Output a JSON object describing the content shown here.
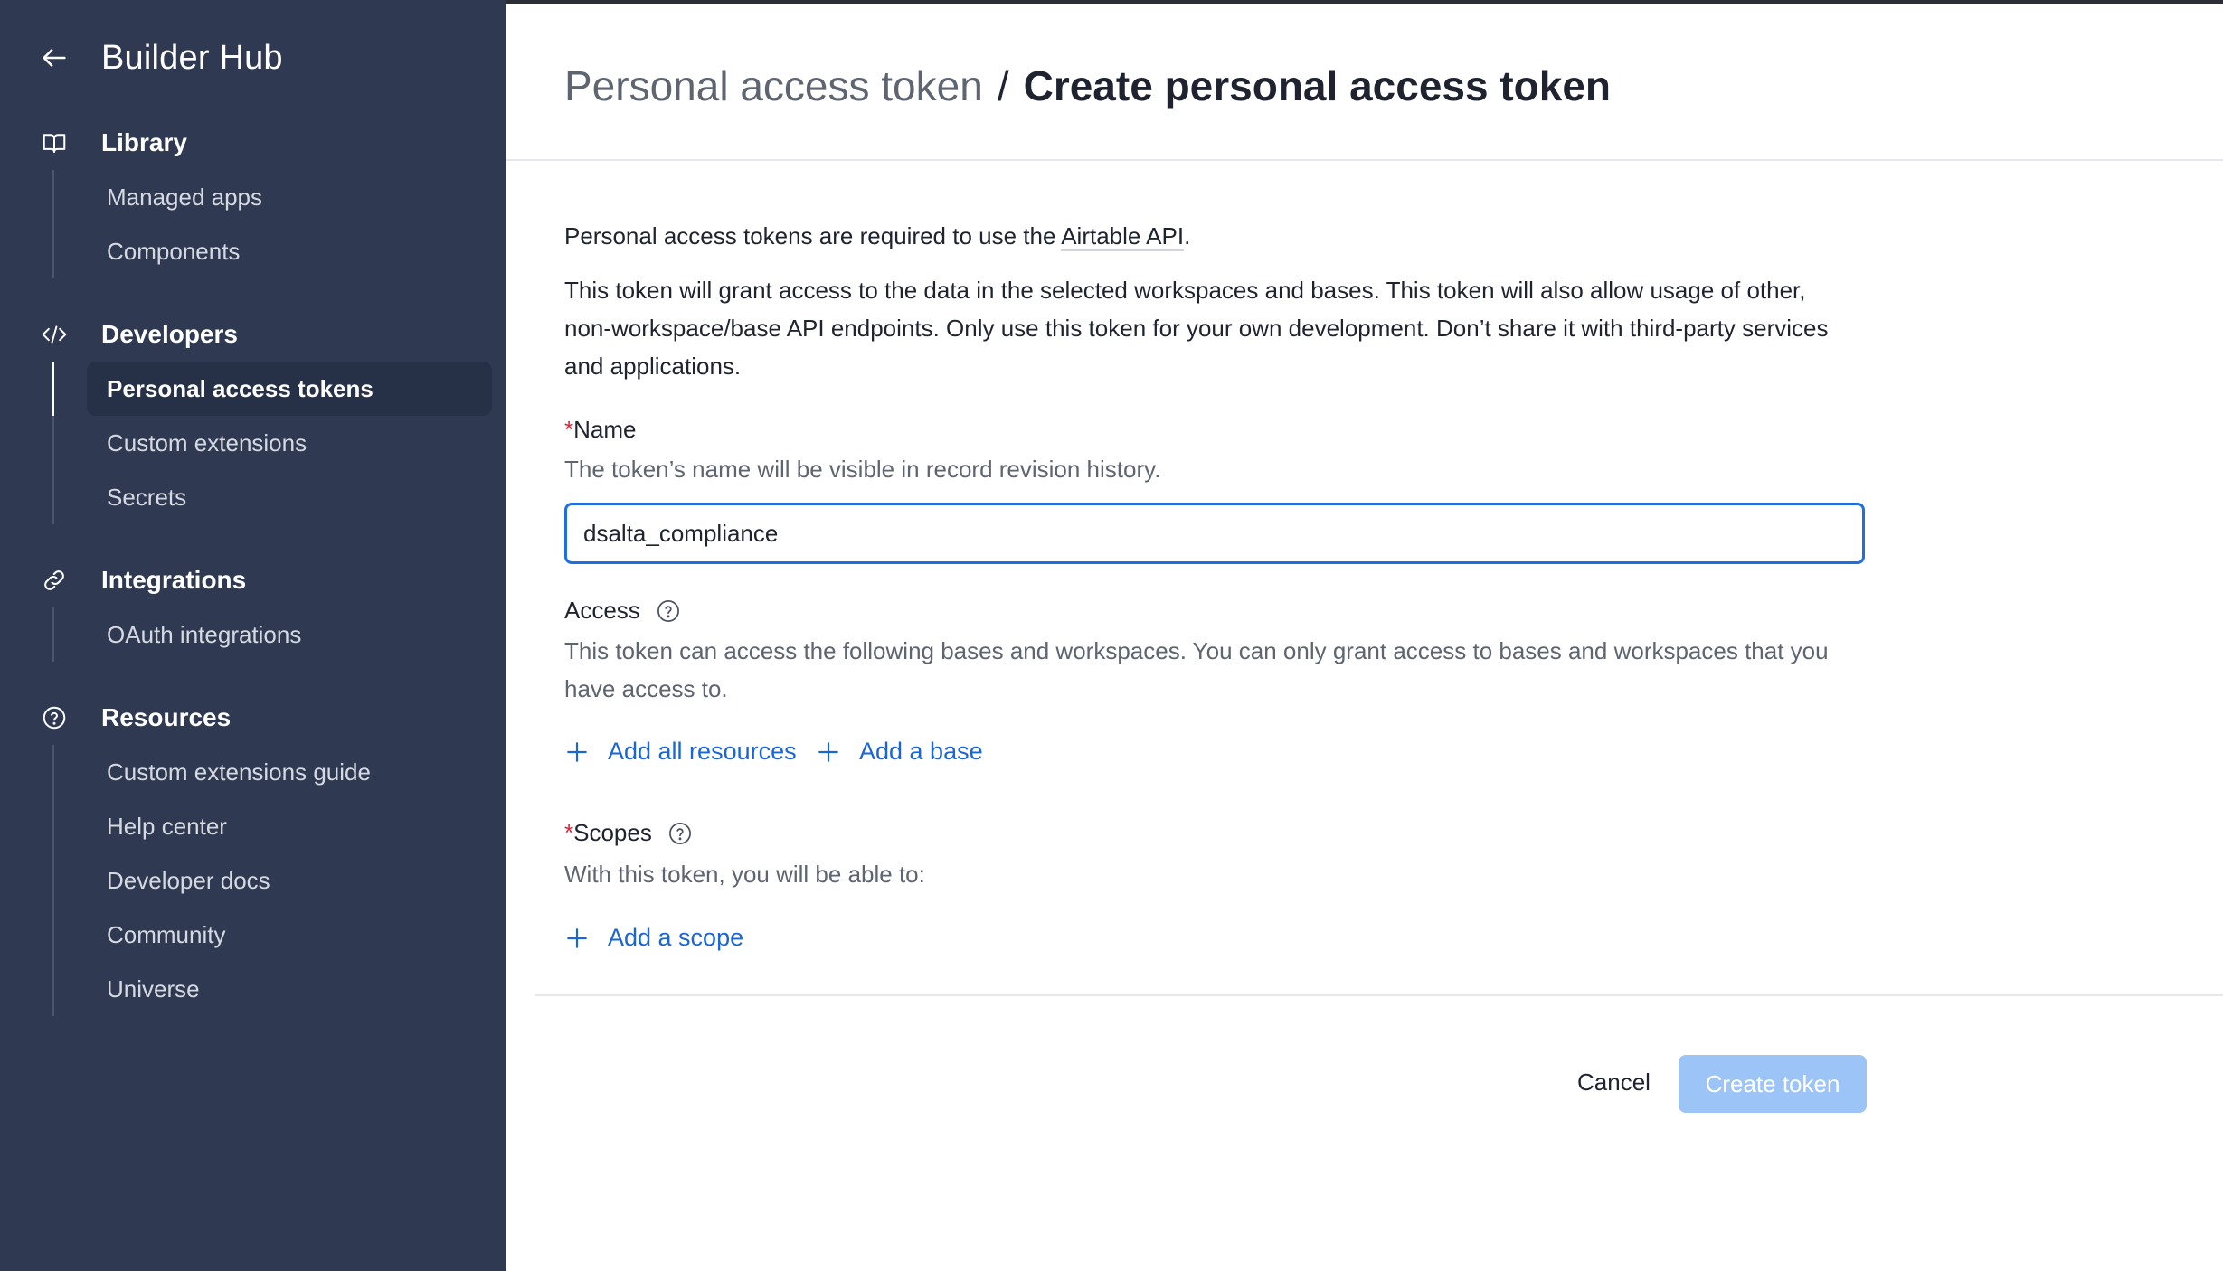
{
  "sidebar": {
    "title": "Builder Hub",
    "sections": [
      {
        "label": "Library",
        "icon": "book-icon",
        "items": [
          {
            "label": "Managed apps"
          },
          {
            "label": "Components"
          }
        ]
      },
      {
        "label": "Developers",
        "icon": "code-icon",
        "items": [
          {
            "label": "Personal access tokens",
            "active": true
          },
          {
            "label": "Custom extensions"
          },
          {
            "label": "Secrets"
          }
        ]
      },
      {
        "label": "Integrations",
        "icon": "link-icon",
        "items": [
          {
            "label": "OAuth integrations"
          }
        ]
      },
      {
        "label": "Resources",
        "icon": "help-circle-icon",
        "items": [
          {
            "label": "Custom extensions guide"
          },
          {
            "label": "Help center"
          },
          {
            "label": "Developer docs"
          },
          {
            "label": "Community"
          },
          {
            "label": "Universe"
          }
        ]
      }
    ]
  },
  "header": {
    "parent": "Personal access token",
    "separator": "/",
    "current": "Create personal access token"
  },
  "intro": {
    "line1_prefix": "Personal access tokens are required to use the ",
    "line1_link": "Airtable API",
    "line1_suffix": ".",
    "line2": "This token will grant access to the data in the selected workspaces and bases. This token will also allow usage of other, non-workspace/base API endpoints. Only use this token for your own development. Don’t share it with third-party services and applications."
  },
  "name_field": {
    "required_mark": "*",
    "label": "Name",
    "help": "The token’s name will be visible in record revision history.",
    "value": "dsalta_compliance"
  },
  "access": {
    "label": "Access",
    "help": "This token can access the following bases and workspaces. You can only grant access to bases and workspaces that you have access to.",
    "add_all": "Add all resources",
    "add_base": "Add a base"
  },
  "scopes": {
    "required_mark": "*",
    "label": "Scopes",
    "help": "With this token, you will be able to:",
    "add_scope": "Add a scope"
  },
  "footer": {
    "cancel": "Cancel",
    "create": "Create token"
  },
  "colors": {
    "sidebar_bg": "#2f3a52",
    "accent_link": "#1a66d6",
    "input_focus": "#1f6fe0",
    "create_disabled": "#9cc4f6",
    "required": "#d7263d"
  }
}
